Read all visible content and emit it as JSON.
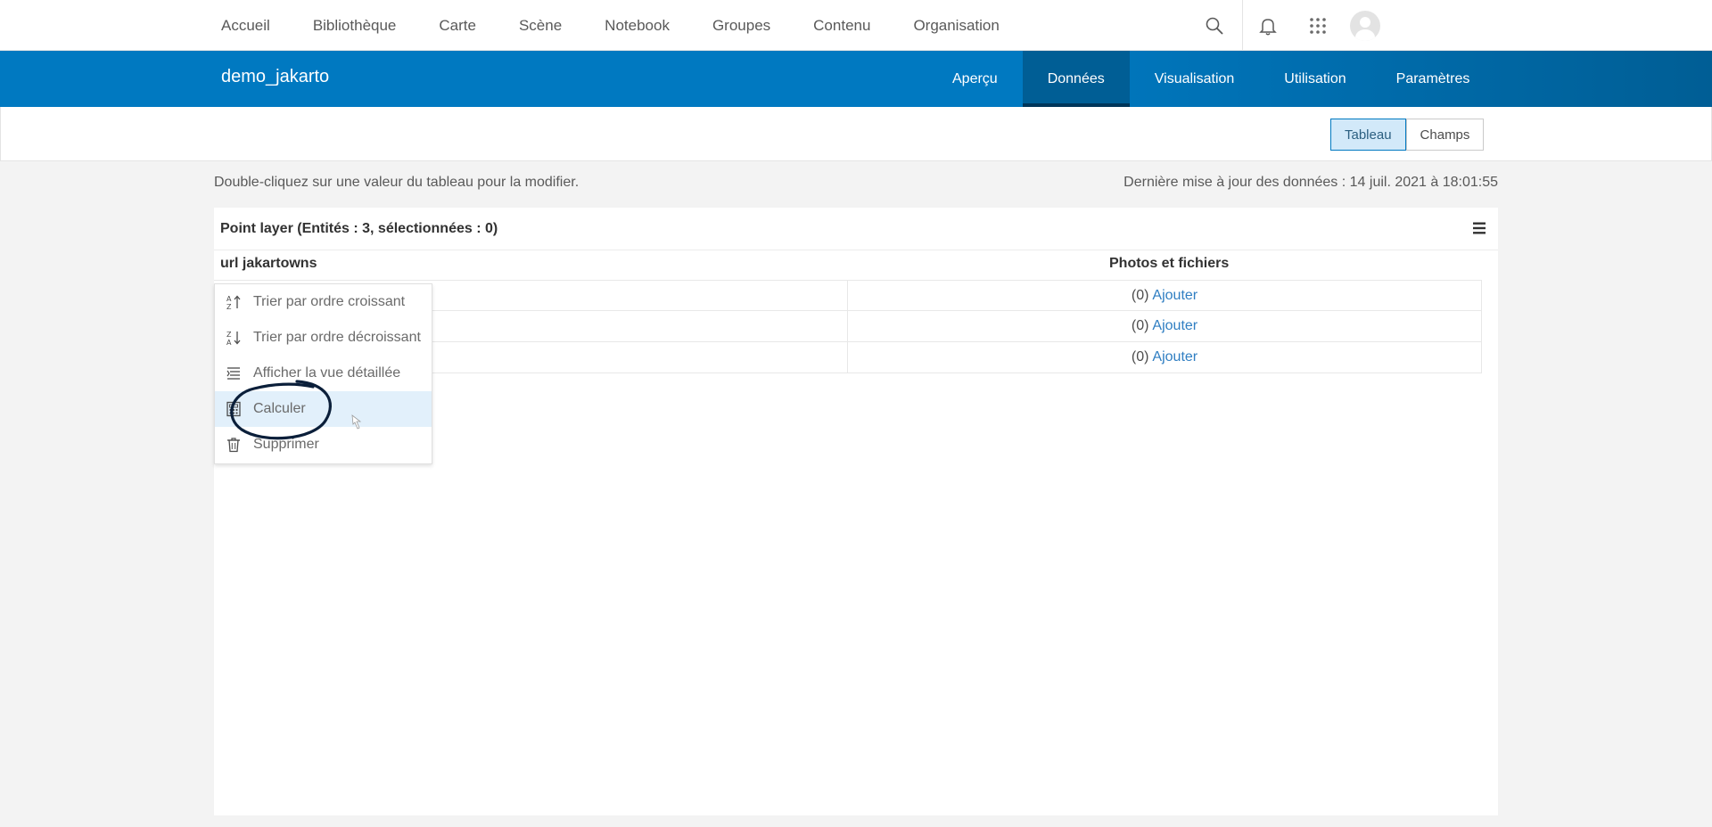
{
  "topnav": {
    "links": [
      "Accueil",
      "Bibliothèque",
      "Carte",
      "Scène",
      "Notebook",
      "Groupes",
      "Contenu",
      "Organisation"
    ],
    "icons": [
      "search-icon",
      "bell-icon",
      "app-launcher-icon",
      "avatar-icon"
    ]
  },
  "item": {
    "title": "demo_jakarto",
    "tabs": [
      "Aperçu",
      "Données",
      "Visualisation",
      "Utilisation",
      "Paramètres"
    ],
    "active_tab": "Données"
  },
  "view_toggle": {
    "options": [
      "Tableau",
      "Champs"
    ],
    "selected": "Tableau"
  },
  "hint": "Double-cliquez sur une valeur du tableau pour la modifier.",
  "updated": "Dernière mise à jour des données : 14 juil. 2021 à 18:01:55",
  "table": {
    "title": "Point layer (Entités : 3, sélectionnées : 0)",
    "columns": [
      "url jakartowns",
      "Photos et fichiers"
    ],
    "rows": [
      {
        "count": "(0)",
        "action": "Ajouter"
      },
      {
        "count": "(0)",
        "action": "Ajouter"
      },
      {
        "count": "(0)",
        "action": "Ajouter"
      }
    ]
  },
  "context_menu": {
    "items": [
      {
        "label": "Trier par ordre croissant",
        "icon": "sort-ascending-icon"
      },
      {
        "label": "Trier par ordre décroissant",
        "icon": "sort-descending-icon"
      },
      {
        "label": "Afficher la vue détaillée",
        "icon": "detail-view-icon"
      },
      {
        "label": "Calculer",
        "icon": "calculator-icon",
        "highlighted": true
      },
      {
        "label": "Supprimer",
        "icon": "trash-icon"
      }
    ]
  },
  "colors": {
    "brand_blue": "#0079c1",
    "active_tab": "#005e95",
    "link": "#2f7ec2",
    "highlight": "#e2f0fb",
    "annotation": "#0b1f3a"
  }
}
